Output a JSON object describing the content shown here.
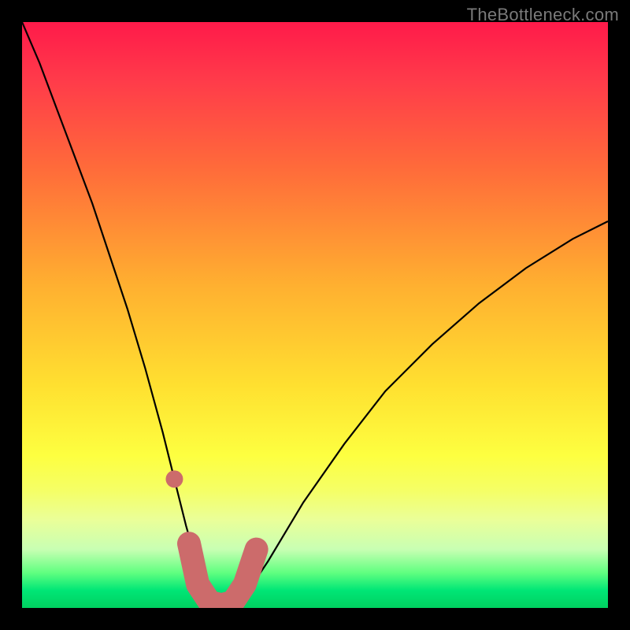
{
  "watermark": "TheBottleneck.com",
  "chart_data": {
    "type": "line",
    "title": "",
    "xlabel": "",
    "ylabel": "",
    "xlim": [
      0,
      100
    ],
    "ylim": [
      0,
      100
    ],
    "series": [
      {
        "name": "bottleneck-curve",
        "x": [
          0,
          3,
          6,
          9,
          12,
          15,
          18,
          21,
          24,
          26,
          28,
          30,
          32,
          34,
          36,
          38,
          42,
          48,
          55,
          62,
          70,
          78,
          86,
          94,
          100
        ],
        "y": [
          100,
          93,
          85,
          77,
          69,
          60,
          51,
          41,
          30,
          22,
          14,
          7,
          2,
          0,
          0,
          2,
          8,
          18,
          28,
          37,
          45,
          52,
          58,
          63,
          66
        ]
      }
    ],
    "highlight": {
      "name": "optimal-range",
      "color": "#cc6b6b",
      "points_xy": [
        [
          26,
          22
        ],
        [
          28.5,
          11
        ],
        [
          30,
          4
        ],
        [
          32,
          1
        ],
        [
          34,
          0.5
        ],
        [
          36,
          1
        ],
        [
          38,
          4
        ],
        [
          40,
          10
        ]
      ],
      "marker_radius_px": 15
    },
    "background_gradient_meaning": "red=high-bottleneck, green=balanced"
  },
  "colors": {
    "frame": "#000000",
    "curve": "#000000",
    "highlight_stroke": "#cc6b6b",
    "highlight_dot": "#cc6b6b"
  }
}
